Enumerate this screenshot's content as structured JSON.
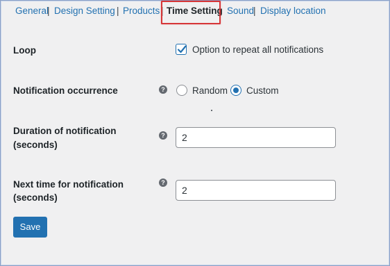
{
  "tabs": [
    {
      "label": "General"
    },
    {
      "label": "Design Setting"
    },
    {
      "label": "Products"
    },
    {
      "label": "Time Setting"
    },
    {
      "label": "Sound"
    },
    {
      "label": "Display location"
    }
  ],
  "separator": "|",
  "loop": {
    "label": "Loop",
    "checkbox_label": "Option to repeat all notifications",
    "checked": true
  },
  "occurrence": {
    "label": "Notification occurrence",
    "options": [
      "Random",
      "Custom"
    ],
    "selected": "Custom"
  },
  "duration": {
    "label_line1": "Duration of notification",
    "label_line2": "(seconds)",
    "value": "2"
  },
  "next_time": {
    "label_line1": "Next time for notification",
    "label_line2": "(seconds)",
    "value": "2"
  },
  "help_icon": "?",
  "save_label": "Save",
  "colors": {
    "accent": "#2271b1",
    "highlight": "#d63638"
  }
}
